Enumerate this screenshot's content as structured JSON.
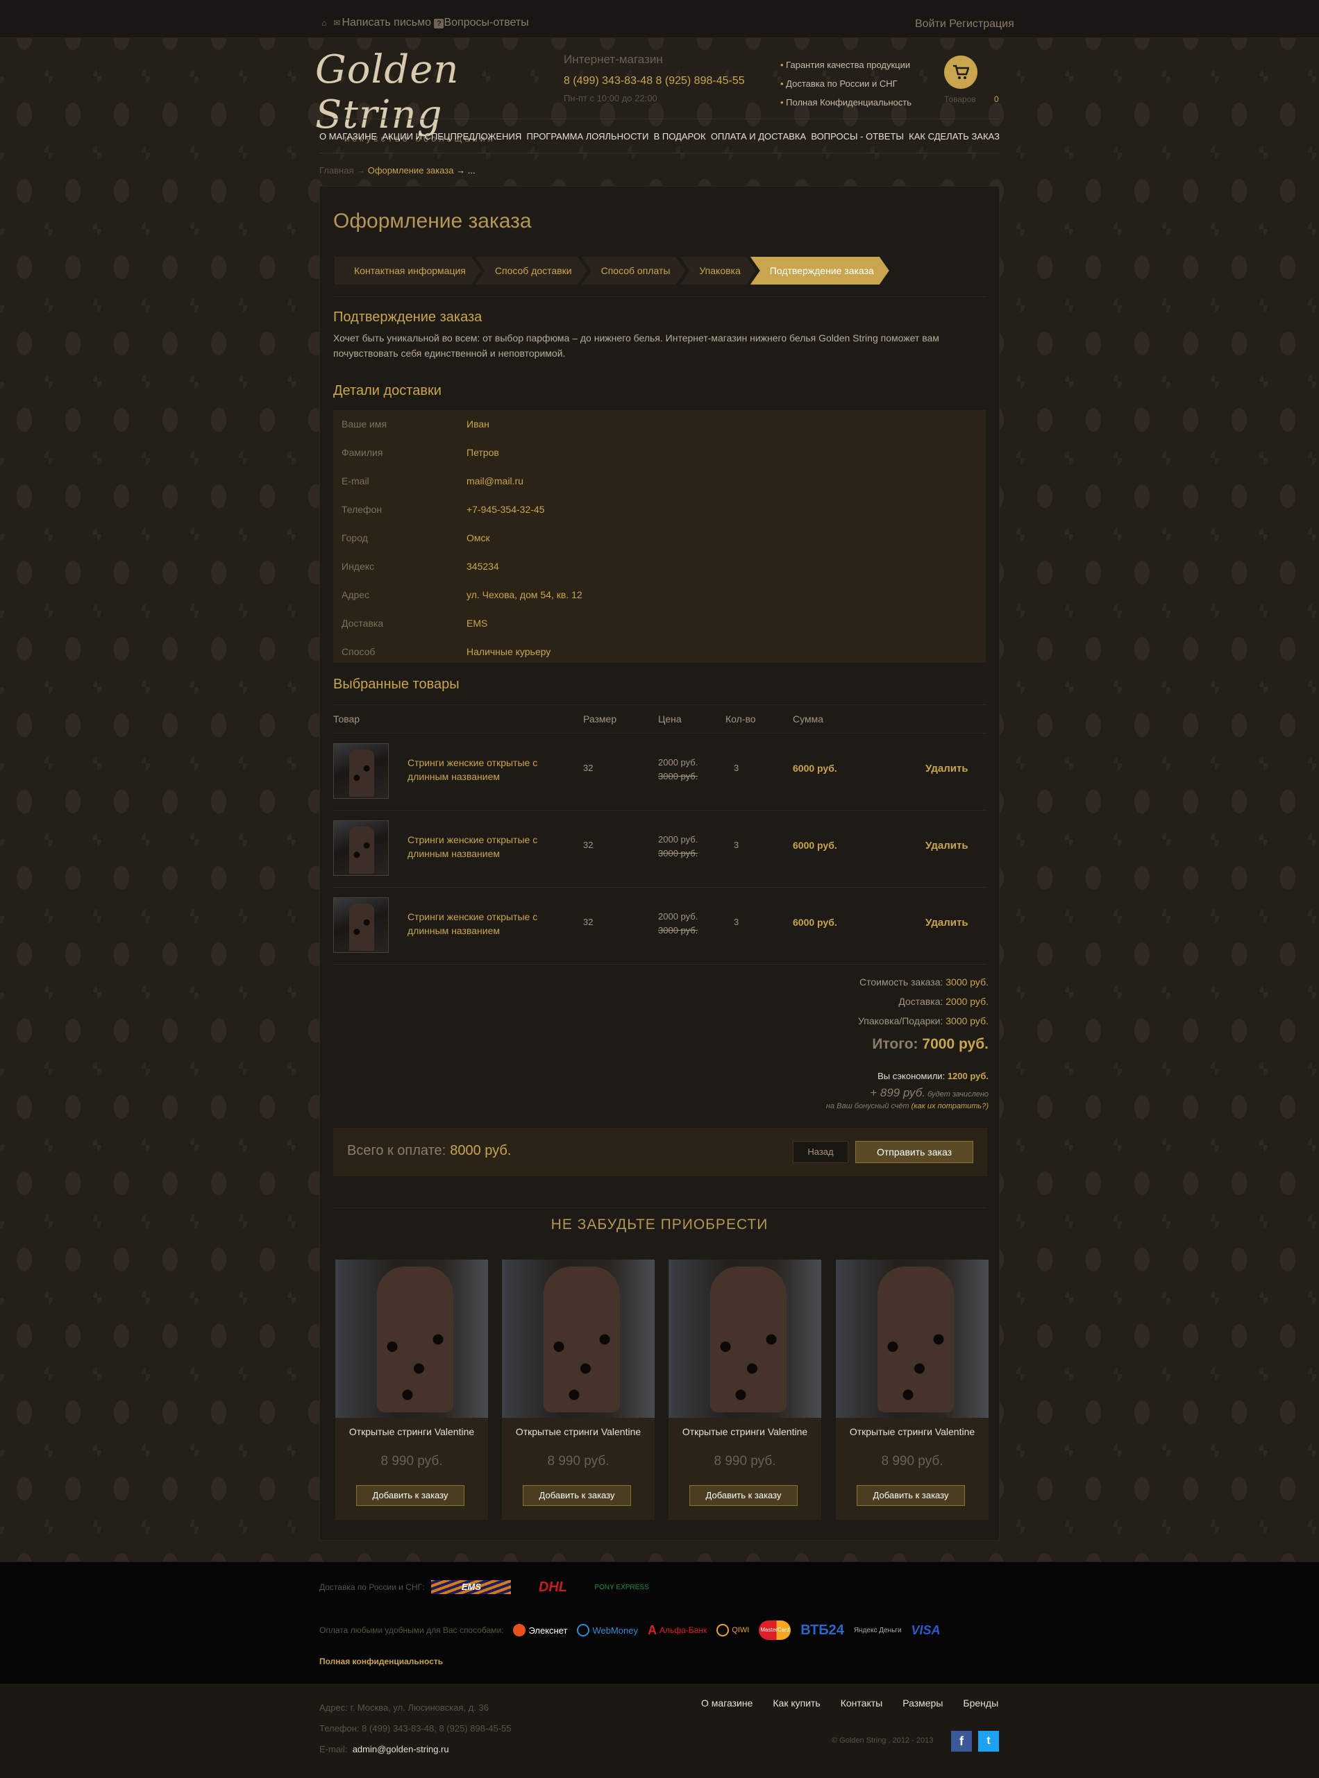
{
  "colors": {
    "accent": "#c9a54e",
    "bg": "#1f1b16",
    "panel": "#2a2316"
  },
  "topbar": {
    "write_letter": "Написать письмо",
    "faq": "Вопросы-ответы",
    "login": "Войти",
    "register": "Регистрация"
  },
  "header": {
    "logo_name": "Golden String",
    "logo_tagline": "искусство обольщения",
    "shop_label": "Интернет-магазин",
    "phones": "8 (499) 343-83-48   8 (925) 898-45-55",
    "hours": "Пн-пт с 10:00 до 22:00",
    "guarantees": [
      "Гарантия качества продукции",
      "Доставка по России и СНГ",
      "Полная Конфиденциальность"
    ],
    "cart_label": "Товаров",
    "cart_count": "0"
  },
  "nav": [
    "О МАГАЗИНЕ",
    "АКЦИИ И СПЕЦПРЕДЛОЖЕНИЯ",
    "ПРОГРАММА ЛОЯЛЬНОСТИ",
    "В ПОДАРОК",
    "ОПЛАТА И ДОСТАВКА",
    "ВОПРОСЫ - ОТВЕТЫ",
    "КАК СДЕЛАТЬ ЗАКАЗ"
  ],
  "breadcrumb": {
    "home": "Главная",
    "sep": "→",
    "current": "Оформление заказа",
    "dots": "..."
  },
  "page": {
    "title": "Оформление заказа",
    "steps": [
      "Контактная информация",
      "Способ доставки",
      "Способ оплаты",
      "Упаковка",
      "Подтверждение заказа"
    ],
    "confirm_title": "Подтверждение заказа",
    "confirm_text": "Хочет быть уникальной во всем: от выбор парфюма – до нижнего белья. Интернет-магазин нижнего белья Golden String поможет вам почувствовать себя единственной и неповторимой.",
    "details_title": "Детали доставки",
    "details": [
      {
        "k": "Ваше имя",
        "v": "Иван"
      },
      {
        "k": "Фамилия",
        "v": "Петров"
      },
      {
        "k": "E-mail",
        "v": "mail@mail.ru"
      },
      {
        "k": "Телефон",
        "v": "+7-945-354-32-45"
      },
      {
        "k": "Город",
        "v": "Омск"
      },
      {
        "k": "Индекс",
        "v": "345234"
      },
      {
        "k": "Адрес",
        "v": "ул. Чехова, дом 54, кв. 12"
      },
      {
        "k": "Доставка",
        "v": "EMS"
      },
      {
        "k": "Способ",
        "v": "Наличные курьеру"
      }
    ],
    "items_title": "Выбранные товары",
    "columns": {
      "product": "Товар",
      "size": "Размер",
      "price": "Цена",
      "qty": "Кол-во",
      "sum": "Сумма"
    },
    "items": [
      {
        "name": "Стринги женские открытые с длинным названием",
        "size": "32",
        "price": "2000 руб.",
        "old_price": "3000 руб.",
        "qty": "3",
        "sum": "6000 руб.",
        "delete": "Удалить"
      },
      {
        "name": "Стринги женские открытые с длинным названием",
        "size": "32",
        "price": "2000 руб.",
        "old_price": "3000 руб.",
        "qty": "3",
        "sum": "6000 руб.",
        "delete": "Удалить"
      },
      {
        "name": "Стринги женские открытые с длинным названием",
        "size": "32",
        "price": "2000 руб.",
        "old_price": "3000 руб.",
        "qty": "3",
        "sum": "6000 руб.",
        "delete": "Удалить"
      }
    ],
    "summary": {
      "order_label": "Стоимость заказа:",
      "order_value": "3000 руб.",
      "delivery_label": "Доставка:",
      "delivery_value": "2000 руб.",
      "pack_label": "Упаковка/Подарки:",
      "pack_value": "3000 руб.",
      "total_label": "Итого:",
      "total_value": "7000 руб.",
      "saved_label": "Вы сэкономили:",
      "saved_value": "1200 руб.",
      "bonus_value": "+ 899 руб.",
      "bonus_text1": "будет зачислено",
      "bonus_text2": "на Ваш  бонусный счёт",
      "bonus_link": "(как их потратить?)"
    },
    "pay": {
      "label": "Всего к оплате:",
      "value": "8000 руб.",
      "back": "Назад",
      "send": "Отправить заказ"
    }
  },
  "upsell": {
    "title": "НЕ ЗАБУДЬТЕ ПРИОБРЕСТИ",
    "cards": [
      {
        "name": "Открытые стринги Valentine",
        "price": "8 990 руб.",
        "button": "Добавить к заказу"
      },
      {
        "name": "Открытые стринги Valentine",
        "price": "8 990 руб.",
        "button": "Добавить к заказу"
      },
      {
        "name": "Открытые стринги Valentine",
        "price": "8 990 руб.",
        "button": "Добавить к заказу"
      },
      {
        "name": "Открытые стринги Valentine",
        "price": "8 990 руб.",
        "button": "Добавить к заказу"
      }
    ]
  },
  "footer": {
    "delivery_label": "Доставка по России и СНГ:",
    "delivery_logos": [
      "EMS",
      "DHL",
      "PONY EXPRESS"
    ],
    "pay_label": "Оплата любыми удобными для Вас способами:",
    "pay_logos": [
      "Элекснет",
      "WebMoney",
      "Альфа-Банк",
      "QIWI",
      "MasterCard",
      "ВТБ24",
      "Яндекс Деньги",
      "VISA"
    ],
    "confidential": "Полная конфиденциальность",
    "address": "Адрес: г. Москва, ул. Люсиновская, д. 36",
    "phone": "Телефон:  8 (499) 343-83-48, 8 (925) 898-45-55",
    "email_label": "E-mail:",
    "email": "admin@golden-string.ru",
    "links": [
      "О магазине",
      "Как купить",
      "Контакты",
      "Размеры",
      "Бренды"
    ],
    "copyright": "© Golden String , 2012 - 2013"
  }
}
